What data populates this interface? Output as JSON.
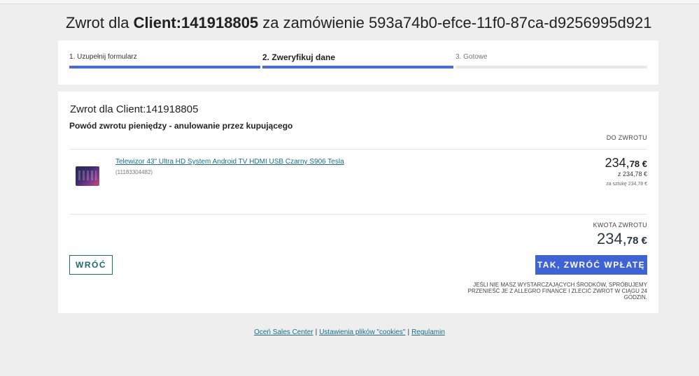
{
  "header": {
    "title_prefix": "Zwrot dla",
    "client": "Client:141918805",
    "title_middle": "za zamówienie",
    "order_id": "593a74b0-efce-11f0-87ca-d9256995d921"
  },
  "stepper": {
    "steps": [
      {
        "label": "1. Uzupełnij formularz",
        "state": "done"
      },
      {
        "label": "2. Zweryfikuj dane",
        "state": "active"
      },
      {
        "label": "3. Gotowe",
        "state": "todo"
      }
    ]
  },
  "card": {
    "title": "Zwrot dla Client:141918805",
    "reason": "Powód zwrotu pieniędzy - anulowanie przez kupującego",
    "column_header": "DO ZWROTU",
    "product": {
      "name": "Telewizor 43\" Ultra HD System Android TV HDMI USB Czarny S906 Tesla",
      "id": "(11183304482)",
      "image_icon": "tv-thumbnail",
      "price_int": "234,",
      "price_dec": "78 €",
      "price_of": "z 234,78 €",
      "price_per_unit": "za sztukę 234,78 €"
    },
    "sum_label": "KWOTA ZWROTU",
    "sum_int": "234,",
    "sum_dec": "78 €",
    "back_label": "WRÓĆ",
    "confirm_label": "TAK, ZWRÓĆ WPŁATĘ",
    "notice": "Jeśli nie masz wystarczających środków, spróbujemy przenieść je z Allegro Finance i zlecić zwrot w ciągu 24 godzin."
  },
  "footer": {
    "links": [
      "Oceń Sales Center",
      "Ustawienia plików \"cookies\"",
      "Regulamin"
    ],
    "separator": "|"
  },
  "colors": {
    "accent": "#3f62d4",
    "link": "#1a6c86",
    "back_button": "#1a6c6f"
  }
}
